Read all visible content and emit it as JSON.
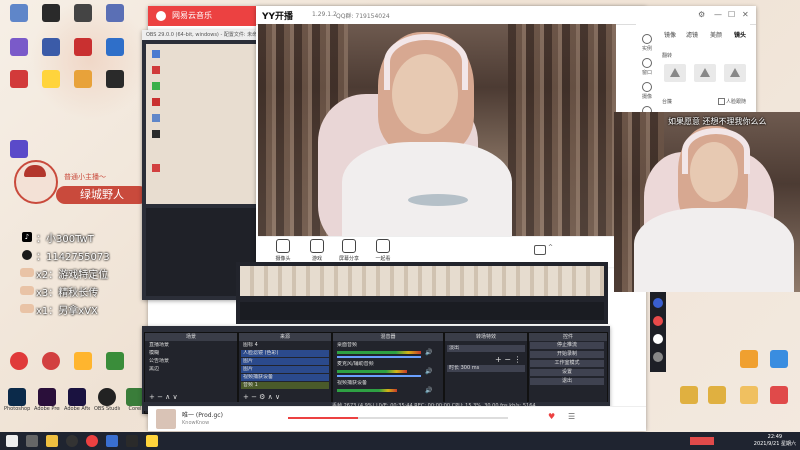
{
  "desktop": {
    "nickname": "绿城野人",
    "profile_line": "普通小主播～",
    "lines": [
      {
        "icon": "tiktok-icon",
        "text": "：小300TwT"
      },
      {
        "icon": "qq-icon",
        "text": "：1142755073"
      },
      {
        "icon": "tag-icon",
        "text": "x2：游戏特定位"
      },
      {
        "icon": "tag-icon",
        "text": "x3：精秋长传"
      },
      {
        "icon": "tag-icon",
        "text": "x1：另拿xVX"
      }
    ],
    "icons": [
      "Photoshop",
      "Adobe Premiere",
      "Adobe After Effects",
      "OBS Studio",
      "Corel"
    ]
  },
  "netease": {
    "title": "网易云音乐",
    "song": "唯一 (Prod.gc)",
    "artist": "KnowKnow"
  },
  "obs_back": {
    "title": "OBS 29.0.0 (64-bit, windows) - 配置文件: 未命名"
  },
  "yy": {
    "brand": "YY开播",
    "version": "1.29.1.2",
    "qd": "QQ群: 719154024",
    "side_tabs": [
      "实例",
      "窗口",
      "摄像",
      "美化"
    ],
    "side_headers": [
      "镜像",
      "滤镜",
      "美颜",
      "镜头"
    ],
    "mirror_label": "翻转",
    "stage_label": "台簾",
    "portrait_label": "人脸跟随",
    "tools": [
      "摄像头",
      "游戏",
      "屏幕分享",
      "一起看"
    ],
    "overlay": "如果愿意 还想不理我你么么"
  },
  "obs": {
    "docks": [
      {
        "title": "场景",
        "rows": [
          "直播场景",
          "模糊",
          "公告场景",
          "黑边"
        ]
      },
      {
        "title": "来源",
        "rows": [
          "图标 4",
          "人脸滤镜 (色彩)",
          "图片",
          "图片",
          "视频捕获设备",
          "音频 1"
        ]
      },
      {
        "title": "混音器",
        "rows": [
          "桌面音频",
          "麦克风/辅助音频",
          "视频捕获设备"
        ]
      },
      {
        "title": "转场特效",
        "rows": [
          "淡出",
          "时长 300 ms"
        ]
      },
      {
        "title": "控件",
        "rows": [
          "停止推流",
          "开始录制",
          "工作室模式",
          "设置",
          "退出"
        ]
      }
    ],
    "mixer_levels": [
      -10.0,
      -6.0,
      -15.7
    ],
    "status": "丢帧 2673 (4.9%)   LIVE: 00:35:44   REC: 00:00:00   CPU: 15.3%, 30.00 fps   kb/s: 5164"
  },
  "taskbar": {
    "time": "22:49",
    "date": "2021/9/21 星期六"
  },
  "colors": {
    "netease_red": "#ec4141",
    "obs_dark": "#2b2e38",
    "nickname_bg": "#c94a3c"
  }
}
